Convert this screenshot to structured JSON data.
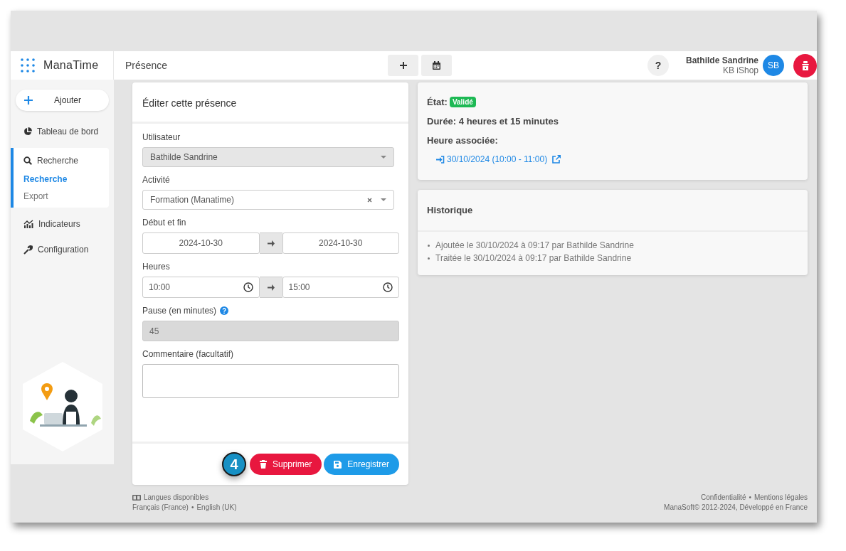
{
  "header": {
    "app_name": "ManaTime",
    "page_title": "Présence",
    "help": "?",
    "user": {
      "name": "Bathilde Sandrine",
      "company": "KB iShop",
      "initials": "SB"
    }
  },
  "sidebar": {
    "add_button": "Ajouter",
    "items": [
      {
        "label": "Tableau de bord",
        "expanded": false
      },
      {
        "label": "Recherche",
        "expanded": true,
        "children": [
          {
            "label": "Recherche",
            "selected": true
          },
          {
            "label": "Export",
            "selected": false
          }
        ]
      },
      {
        "label": "Indicateurs",
        "expanded": false
      },
      {
        "label": "Configuration",
        "expanded": false
      }
    ]
  },
  "form": {
    "title": "Éditer cette présence",
    "fields": [
      {
        "kind": "select",
        "label": "Utilisateur",
        "value": "Bathilde Sandrine",
        "disabled": true,
        "clearable": false
      },
      {
        "kind": "select",
        "label": "Activité",
        "value": "Formation (Manatime)",
        "disabled": false,
        "clearable": true
      },
      {
        "kind": "range",
        "label": "Début et fin",
        "from": "2024-10-30",
        "to": "2024-10-30",
        "time": false
      },
      {
        "kind": "range",
        "label": "Heures",
        "from": "10:00",
        "to": "15:00",
        "time": true
      },
      {
        "kind": "number",
        "label": "Pause (en minutes)",
        "value": "45",
        "disabled": true,
        "help": true
      },
      {
        "kind": "textarea",
        "label": "Commentaire (facultatif)"
      }
    ],
    "step_badge": "4",
    "delete_button": "Supprimer",
    "save_button": "Enregistrer"
  },
  "details": {
    "state_label": "État:",
    "state_badge": "Validé",
    "duration": "Durée: 4 heures et 15 minutes",
    "associated_label": "Heure associée:",
    "associated_link": "30/10/2024 (10:00 - 11:00)"
  },
  "history": {
    "title": "Historique",
    "entries": [
      "Ajoutée le 30/10/2024 à 09:17 par Bathilde Sandrine",
      "Traitée le 30/10/2024 à 09:17 par Bathilde Sandrine"
    ]
  },
  "footer": {
    "languages_title": "Langues disponibles",
    "languages": [
      "Français (France)",
      "English (UK)"
    ],
    "separator": "•",
    "links": [
      "Confidentialité",
      "Mentions légales"
    ],
    "copyright": "ManaSoft© 2012-2024, Développé en France"
  }
}
